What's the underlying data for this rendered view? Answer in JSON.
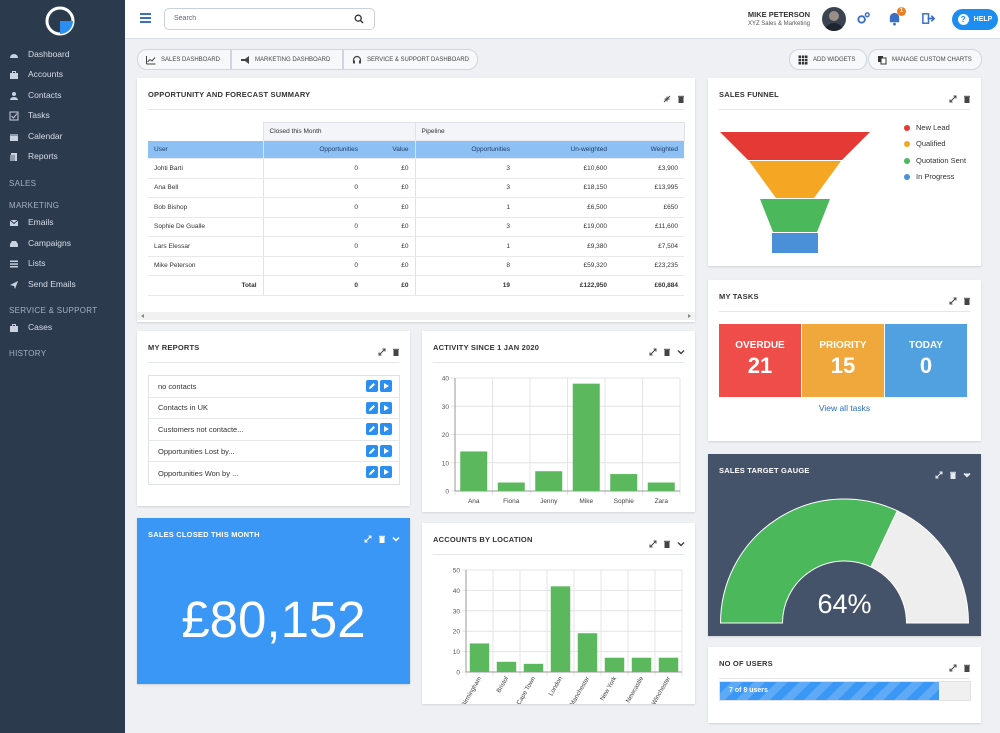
{
  "sidebar": {
    "items": [
      {
        "label": "Dashboard",
        "icon": "dashboard-icon"
      },
      {
        "label": "Accounts",
        "icon": "briefcase-icon"
      },
      {
        "label": "Contacts",
        "icon": "users-icon"
      },
      {
        "label": "Tasks",
        "icon": "checkbox-icon"
      },
      {
        "label": "Calendar",
        "icon": "calendar-icon"
      },
      {
        "label": "Reports",
        "icon": "reports-icon"
      }
    ],
    "sections": {
      "sales": "SALES",
      "marketing": "MARKETING",
      "service": "SERVICE & SUPPORT",
      "history": "HISTORY"
    },
    "marketing_items": [
      {
        "label": "Emails",
        "icon": "envelope-icon"
      },
      {
        "label": "Campaigns",
        "icon": "inbox-icon"
      },
      {
        "label": "Lists",
        "icon": "list-icon"
      },
      {
        "label": "Send Emails",
        "icon": "send-icon"
      }
    ],
    "service_items": [
      {
        "label": "Cases",
        "icon": "case-icon"
      }
    ]
  },
  "topbar": {
    "search_placeholder": "Search",
    "user_name": "MIKE PETERSON",
    "company": "XYZ Sales & Marketing",
    "notification_count": "1",
    "help_label": "HELP"
  },
  "toolbar": {
    "tabs": [
      "SALES DASHBOARD",
      "MARKETING DASHBOARD",
      "SERVICE & SUPPORT DASHBOARD"
    ],
    "add_widgets": "ADD WIDGETS",
    "manage_charts": "MANAGE CUSTOM CHARTS"
  },
  "forecast": {
    "title": "OPPORTUNITY AND FORECAST SUMMARY",
    "group_closed": "Closed this Month",
    "group_pipeline": "Pipeline",
    "headers": [
      "User",
      "Opportunities",
      "Value",
      "Opportunities",
      "Un-weighted",
      "Weighted"
    ],
    "rows": [
      [
        "Johti Barti",
        "0",
        "£0",
        "3",
        "£10,600",
        "£3,900"
      ],
      [
        "Ana Bell",
        "0",
        "£0",
        "3",
        "£18,150",
        "£13,995"
      ],
      [
        "Bob Bishop",
        "0",
        "£0",
        "1",
        "£6,500",
        "£650"
      ],
      [
        "Sophie De Gualle",
        "0",
        "£0",
        "3",
        "£19,000",
        "£11,600"
      ],
      [
        "Lars Elessar",
        "0",
        "£0",
        "1",
        "£9,380",
        "£7,504"
      ],
      [
        "Mike Peterson",
        "0",
        "£0",
        "8",
        "£59,320",
        "£23,235"
      ]
    ],
    "total": [
      "Total",
      "0",
      "£0",
      "19",
      "£122,950",
      "£60,884"
    ]
  },
  "reports": {
    "title": "MY REPORTS",
    "items": [
      "no contacts",
      "Contacts in UK",
      "Customers not contacte...",
      "Opportunities Lost by...",
      "Opportunities Won by ..."
    ]
  },
  "sales_closed": {
    "title": "SALES CLOSED THIS MONTH",
    "value": "£80,152"
  },
  "funnel": {
    "title": "SALES FUNNEL",
    "legend": [
      {
        "label": "New Lead",
        "color": "#e53935"
      },
      {
        "label": "Qualified",
        "color": "#f5a623"
      },
      {
        "label": "Quotation Sent",
        "color": "#4cb85c"
      },
      {
        "label": "In Progress",
        "color": "#4a90d9"
      }
    ]
  },
  "tasks": {
    "title": "MY TASKS",
    "boxes": [
      {
        "label": "OVERDUE",
        "value": "21",
        "color": "#ef4d4a"
      },
      {
        "label": "PRIORITY",
        "value": "15",
        "color": "#f0a73c"
      },
      {
        "label": "TODAY",
        "value": "0",
        "color": "#51a0e0"
      }
    ],
    "view_all": "View all tasks"
  },
  "gauge": {
    "title": "SALES TARGET GAUGE",
    "value": 64,
    "label": "64%"
  },
  "users": {
    "title": "NO OF USERS",
    "label": "7 of 8 users",
    "fraction": 0.875
  },
  "chart_data": [
    {
      "type": "bar",
      "title": "ACTIVITY SINCE 1 JAN 2020",
      "categories": [
        "Ana",
        "Fiona",
        "Jenny",
        "Mike",
        "Sophie",
        "Zara"
      ],
      "values": [
        14,
        3,
        7,
        38,
        6,
        3
      ],
      "ylim": [
        0,
        40
      ],
      "yticks": [
        0,
        10,
        20,
        30,
        40
      ],
      "color": "#5cb85c"
    },
    {
      "type": "bar",
      "title": "ACCOUNTS BY LOCATION",
      "categories": [
        "Birmingham",
        "Bristol",
        "Cape Town",
        "London",
        "Manchester",
        "New York",
        "Newcastle",
        "Winchester"
      ],
      "values": [
        14,
        5,
        4,
        42,
        19,
        7,
        7,
        7
      ],
      "ylim": [
        0,
        50
      ],
      "yticks": [
        0,
        10,
        20,
        30,
        40,
        50
      ],
      "color": "#5cb85c"
    }
  ]
}
